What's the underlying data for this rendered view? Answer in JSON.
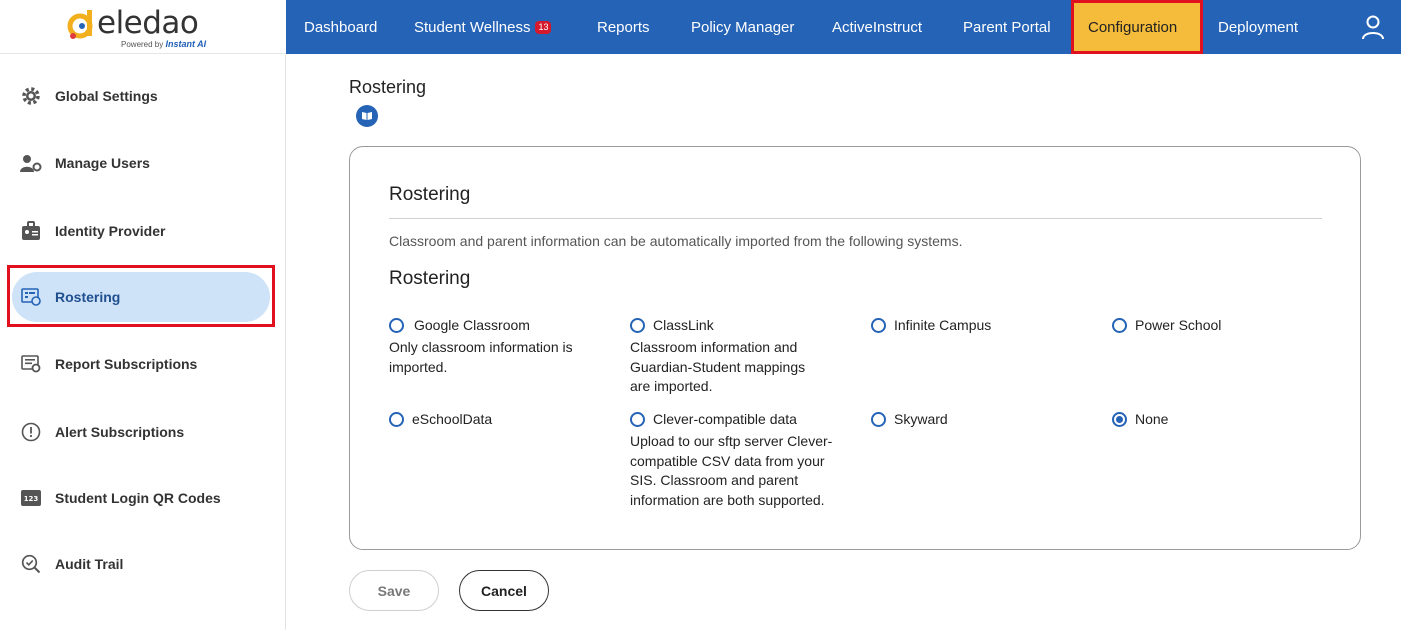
{
  "brand": {
    "name": "eledao",
    "powered_by": "Powered by",
    "powered_brand": "Instant AI"
  },
  "nav": {
    "items": [
      {
        "label": "Dashboard"
      },
      {
        "label": "Student Wellness",
        "badge": "13"
      },
      {
        "label": "Reports"
      },
      {
        "label": "Policy Manager"
      },
      {
        "label": "ActiveInstruct"
      },
      {
        "label": "Parent Portal"
      },
      {
        "label": "Configuration",
        "active": true
      },
      {
        "label": "Deployment"
      }
    ]
  },
  "sidebar": {
    "items": [
      {
        "label": "Global Settings",
        "icon": "gear-icon"
      },
      {
        "label": "Manage Users",
        "icon": "users-gear-icon"
      },
      {
        "label": "Identity Provider",
        "icon": "id-badge-icon"
      },
      {
        "label": "Rostering",
        "icon": "roster-list-icon",
        "active": true
      },
      {
        "label": "Report Subscriptions",
        "icon": "report-gear-icon"
      },
      {
        "label": "Alert Subscriptions",
        "icon": "alert-circle-icon"
      },
      {
        "label": "Student Login QR Codes",
        "icon": "number-123-icon"
      },
      {
        "label": "Audit Trail",
        "icon": "search-check-icon"
      }
    ]
  },
  "main": {
    "page_title": "Rostering",
    "card": {
      "title": "Rostering",
      "description": "Classroom and parent information can be automatically imported from the following systems.",
      "section_title": "Rostering",
      "options": [
        {
          "label": "Google Classroom",
          "desc_lines": [
            "Only classroom information is",
            "imported."
          ],
          "checked": false
        },
        {
          "label": "ClassLink",
          "desc_lines": [
            "Classroom information and",
            "Guardian-Student mappings",
            "are imported."
          ],
          "checked": false
        },
        {
          "label": "Infinite Campus",
          "desc_lines": [],
          "checked": false
        },
        {
          "label": "Power School",
          "desc_lines": [],
          "checked": false
        },
        {
          "label": "eSchoolData",
          "desc_lines": [],
          "checked": false
        },
        {
          "label": "Clever-compatible data",
          "desc_lines": [
            "Upload to our sftp server Clever-",
            "compatible CSV data from your",
            "SIS. Classroom and parent",
            "information are both supported."
          ],
          "checked": false
        },
        {
          "label": "Skyward",
          "desc_lines": [],
          "checked": false
        },
        {
          "label": "None",
          "desc_lines": [],
          "checked": true
        }
      ]
    },
    "save_label": "Save",
    "cancel_label": "Cancel"
  },
  "colors": {
    "nav_bg": "#2563b6",
    "nav_active_bg": "#f4bc3a",
    "highlight_border": "#e0101e",
    "sidebar_active_bg": "#cfe3f8"
  }
}
